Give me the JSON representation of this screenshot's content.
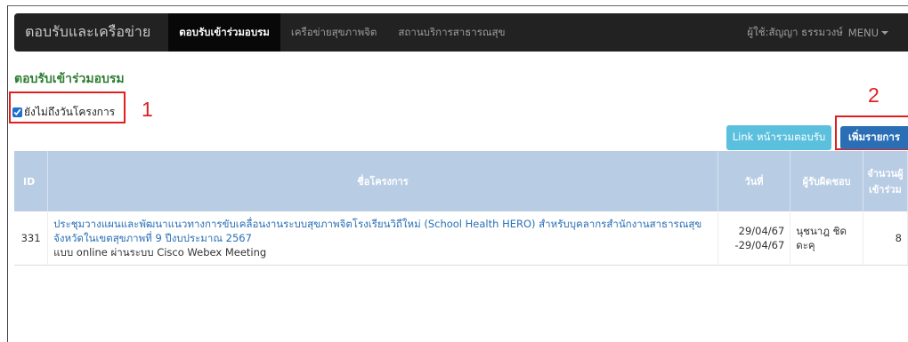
{
  "navbar": {
    "brand": "ตอบรับและเครือข่าย",
    "items": [
      {
        "label": "ตอบรับเข้าร่วมอบรม",
        "active": true
      },
      {
        "label": "เครือข่ายสุขภาพจิต",
        "active": false
      },
      {
        "label": "สถานบริการสาธารณสุข",
        "active": false
      }
    ],
    "user_label": "ผู้ใช้:สัญญา ธรรมวงษ์",
    "menu_label": "MENU"
  },
  "page": {
    "title": "ตอบรับเข้าร่วมอบรม",
    "filter_label": "ยังไม่ถึงวันโครงการ",
    "filter_checked": true
  },
  "annotations": {
    "one": "1",
    "two": "2"
  },
  "buttons": {
    "link_label": "Link หน้ารวมตอบรับ",
    "add_label": "เพิ่มรายการ"
  },
  "table": {
    "headers": {
      "id": "ID",
      "name": "ชื่อโครงการ",
      "date": "วันที่",
      "owner": "ผู้รับผิดชอบ",
      "count": "จำนวนผู้เข้าร่วม"
    },
    "rows": [
      {
        "id": "331",
        "name_line1": "ประชุมวางแผนและพัฒนาแนวทางการขับเคลื่อนงานระบบสุขภาพจิตโรงเรียนวิถีใหม่ (School Health HERO) สำหรับบุคลากรสำนักงานสาธารณสุข",
        "name_line2": "จังหวัดในเขตสุขภาพที่ 9 ปีงบประมาณ 2567",
        "name_sub": "แบบ online ผ่านระบบ Cisco Webex Meeting",
        "date_start": "29/04/67",
        "date_end": "-29/04/67",
        "owner": "นุชนาฎ ชิดดะคุ",
        "count": "8"
      }
    ]
  },
  "colors": {
    "navbar_bg": "#222222",
    "title_green": "#2e7d32",
    "header_bg": "#b8cce4",
    "link_blue": "#2a6fb5",
    "info_button": "#5bc0de",
    "annotation_red": "#e02020"
  }
}
